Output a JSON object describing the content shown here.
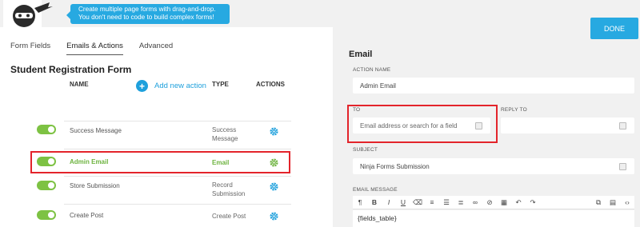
{
  "tooltip": {
    "text": "Create multiple page forms with drag-and-drop. You don't need to code to build complex forms!"
  },
  "done_label": "DONE",
  "tabs": [
    {
      "label": "Form Fields",
      "active": false
    },
    {
      "label": "Emails & Actions",
      "active": true
    },
    {
      "label": "Advanced",
      "active": false
    }
  ],
  "form_title": "Student Registration Form",
  "add_action_label": "Add new action",
  "table": {
    "headers": {
      "name": "NAME",
      "type": "TYPE",
      "actions": "ACTIONS"
    },
    "rows": [
      {
        "name": "Success Message",
        "type": "Success Message",
        "enabled": true
      },
      {
        "name": "Admin Email",
        "type": "Email",
        "enabled": true,
        "highlighted": true
      },
      {
        "name": "Store Submission",
        "type": "Record Submission",
        "enabled": true
      },
      {
        "name": "Create Post",
        "type": "Create Post",
        "enabled": true
      }
    ]
  },
  "email_panel": {
    "title": "Email",
    "action_name_label": "ACTION NAME",
    "action_name_value": "Admin Email",
    "to_label": "TO",
    "to_placeholder": "Email address or search for a field",
    "reply_to_label": "REPLY TO",
    "subject_label": "SUBJECT",
    "subject_value": "Ninja Forms Submission",
    "message_label": "EMAIL MESSAGE",
    "message_value": "{fields_table}"
  },
  "toolbar_icons": [
    "paragraph-icon",
    "bold-icon",
    "italic-icon",
    "underline-icon",
    "eraser-icon",
    "ordered-list-icon",
    "unordered-list-icon",
    "align-icon",
    "link-icon",
    "unlink-icon",
    "table-icon",
    "undo-icon",
    "redo-icon",
    "merge-tags-icon",
    "list-view-icon",
    "code-view-icon"
  ],
  "colors": {
    "accent": "#27a9e1",
    "toggle_on": "#7dc243",
    "highlight_border": "#e3242b",
    "highlight_text": "#6db33f"
  }
}
